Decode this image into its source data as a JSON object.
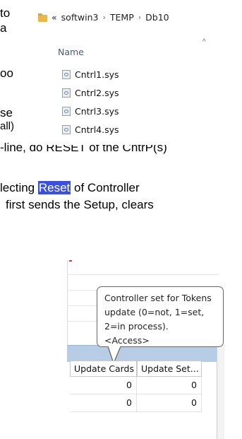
{
  "doc": {
    "line1": "to",
    "line2": "a",
    "line3": "oo",
    "line4": "se",
    "line5": "all)",
    "line6": "-line, do RESET of the CntrP(s)",
    "line7_pre": "lecting ",
    "line7_hl": "Reset",
    "line7_post": " of Controller",
    "line8": "first sends the Setup, clears"
  },
  "explorer": {
    "breadcrumb": [
      "«",
      "softwin3",
      "TEMP",
      "Db10"
    ],
    "column_header": "Name",
    "files": [
      "Cntrl1.sys",
      "Cntrl2.sys",
      "Cntrl3.sys",
      "Cntrl4.sys"
    ]
  },
  "grid": {
    "tooltip": "Controller set for Tokens update (0=not, 1=set, 2=in process). <Access>",
    "columns": [
      "Update Cards",
      "Update Set..."
    ],
    "rows": [
      [
        "0",
        "0"
      ],
      [
        "0",
        "0"
      ]
    ]
  }
}
